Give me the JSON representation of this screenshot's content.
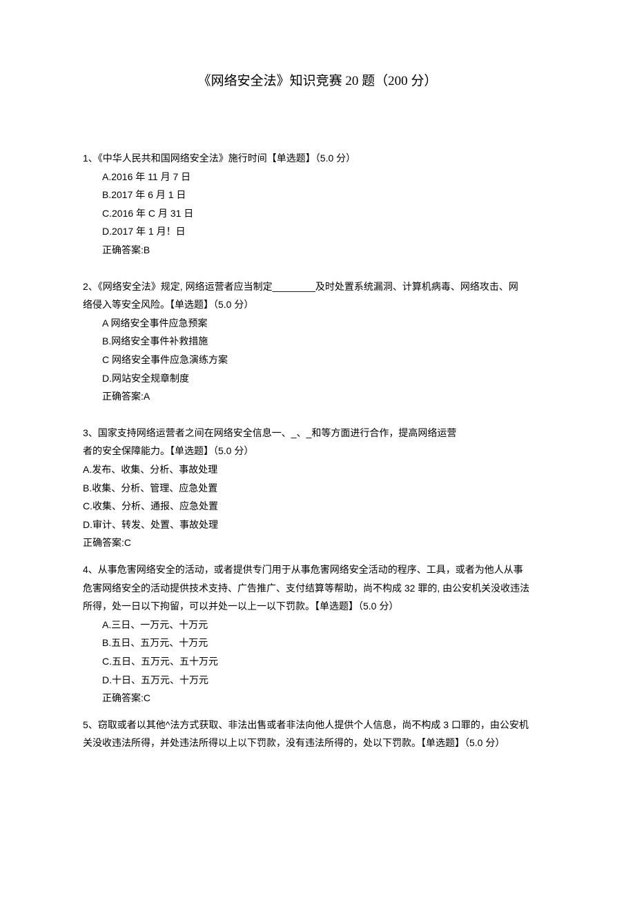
{
  "title": "《网络安全法》知识竞赛 20 题（200 分）",
  "q1": {
    "stem": "1、《中华人民共和国网络安全法》施行时间【单选题】（5.0 分）",
    "a": "A.2016 年 11 月 7 日",
    "b": "B.2017 年 6 月 1 日",
    "c": "C.2016 年 C 月 31 日",
    "d": "D.2017 年 1 月！日",
    "answer": "正确答案:B"
  },
  "q2": {
    "stem1": "2、《网络安全法》规定, 网络运营者应当制定________及时处置系统漏洞、计算机病毒、网络攻击、网",
    "stem2": "络侵入等安全风险。【单选题】（5.0 分）",
    "a": "A 网络安全事件应急预案",
    "b": "B.网络安全事件补救措施",
    "c": "C 网络安全事件应急演练方案",
    "d": "D.网站安全规章制度",
    "answer": "正确答案:A"
  },
  "q3": {
    "stem1": "3、国家支持网络运营者之间在网络安全信息一、_、_和等方面进行合作，提高网络运营",
    "stem2": "者的安全保障能力。【单选题】（5.0 分）",
    "a": "A.发布、收集、分析、事故处理",
    "b": "B.收集、分析、管理、应急处置",
    "c": "C.收集、分析、通报、应急处置",
    "d": "D.审计、转发、处置、事故处理",
    "answer": "正确答案:C"
  },
  "q4": {
    "stem1": "4、从事危害网络安全的活动，或者提供专门用于从事危害网络安全活动的程序、工具，或者为他人从事",
    "stem2": "危害网络安全的活动提供技术支持、广告推广、支付结算等帮助，尚不构成 32 罪的, 由公安机关没收违法",
    "stem3": "所得，处一日以下拘留，可以并处一以上一以下罚款。【单选题】（5.0 分）",
    "a": "A.三日、一万元、十万元",
    "b": "B.五日、五万元、十万元",
    "c": "C.五日、五万元、五十万元",
    "d": "D.十日、五万元、十万元",
    "answer": "正确答案:C"
  },
  "q5": {
    "stem1": "5、窃取或者以其他^法方式获取、非法出售或者非法向他人提供个人信息，尚不构成 3 口罪的，由公安机",
    "stem2": "关没收违法所得，并处违法所得以上以下罚款，没有违法所得的，处以下罚款。【单选题】（5.0 分）"
  }
}
